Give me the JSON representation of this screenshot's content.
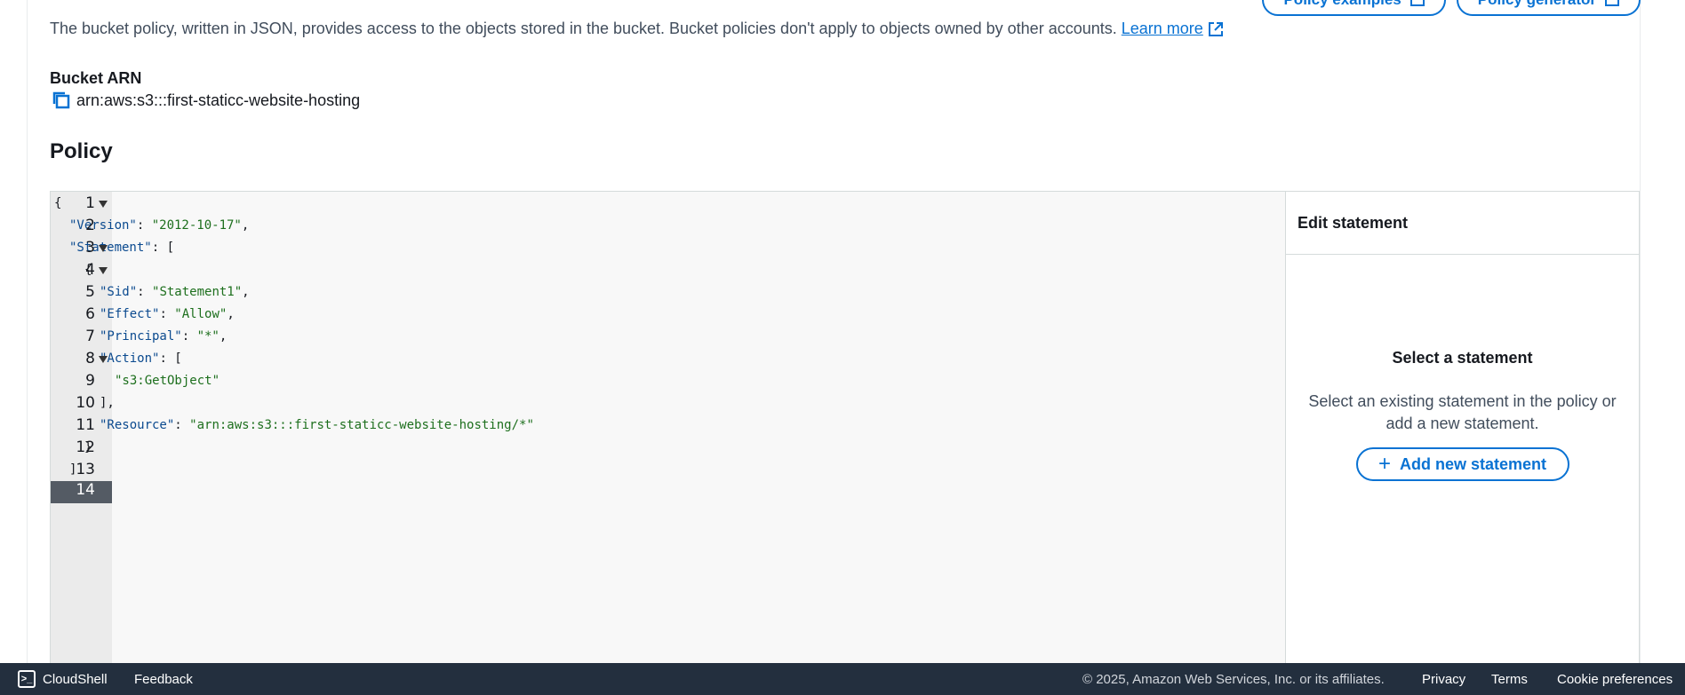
{
  "header_buttons": {
    "policy_examples": "Policy examples",
    "policy_generator": "Policy generator"
  },
  "description": {
    "text": "The bucket policy, written in JSON, provides access to the objects stored in the bucket. Bucket policies don't apply to objects owned by other accounts.",
    "learn_more": "Learn more"
  },
  "bucket_arn": {
    "label": "Bucket ARN",
    "value": "arn:aws:s3:::first-staticc-website-hosting"
  },
  "policy": {
    "title": "Policy",
    "active_line": 14,
    "lines": [
      {
        "num": "1",
        "fold": true,
        "indent": 0,
        "parts": [
          {
            "t": "p",
            "v": "{"
          }
        ]
      },
      {
        "num": "2",
        "fold": false,
        "indent": 1,
        "parts": [
          {
            "t": "k",
            "v": "\"Version\""
          },
          {
            "t": "p",
            "v": ": "
          },
          {
            "t": "s",
            "v": "\"2012-10-17\""
          },
          {
            "t": "p",
            "v": ","
          }
        ]
      },
      {
        "num": "3",
        "fold": true,
        "indent": 1,
        "parts": [
          {
            "t": "k",
            "v": "\"Statement\""
          },
          {
            "t": "p",
            "v": ": ["
          }
        ]
      },
      {
        "num": "4",
        "fold": true,
        "indent": 2,
        "parts": [
          {
            "t": "p",
            "v": "{"
          }
        ]
      },
      {
        "num": "5",
        "fold": false,
        "indent": 3,
        "parts": [
          {
            "t": "k",
            "v": "\"Sid\""
          },
          {
            "t": "p",
            "v": ": "
          },
          {
            "t": "s",
            "v": "\"Statement1\""
          },
          {
            "t": "p",
            "v": ","
          }
        ]
      },
      {
        "num": "6",
        "fold": false,
        "indent": 3,
        "parts": [
          {
            "t": "k",
            "v": "\"Effect\""
          },
          {
            "t": "p",
            "v": ": "
          },
          {
            "t": "s",
            "v": "\"Allow\""
          },
          {
            "t": "p",
            "v": ","
          }
        ]
      },
      {
        "num": "7",
        "fold": false,
        "indent": 3,
        "parts": [
          {
            "t": "k",
            "v": "\"Principal\""
          },
          {
            "t": "p",
            "v": ": "
          },
          {
            "t": "s",
            "v": "\"*\""
          },
          {
            "t": "p",
            "v": ","
          }
        ]
      },
      {
        "num": "8",
        "fold": true,
        "indent": 3,
        "parts": [
          {
            "t": "k",
            "v": "\"Action\""
          },
          {
            "t": "p",
            "v": ": ["
          }
        ]
      },
      {
        "num": "9",
        "fold": false,
        "indent": 4,
        "parts": [
          {
            "t": "s",
            "v": "\"s3:GetObject\""
          }
        ]
      },
      {
        "num": "10",
        "fold": false,
        "indent": 3,
        "parts": [
          {
            "t": "p",
            "v": "],"
          }
        ]
      },
      {
        "num": "11",
        "fold": false,
        "indent": 3,
        "parts": [
          {
            "t": "k",
            "v": "\"Resource\""
          },
          {
            "t": "p",
            "v": ": "
          },
          {
            "t": "s",
            "v": "\"arn:aws:s3:::first-staticc-website-hosting/*\""
          }
        ]
      },
      {
        "num": "12",
        "fold": false,
        "indent": 2,
        "parts": [
          {
            "t": "p",
            "v": "}"
          }
        ]
      },
      {
        "num": "13",
        "fold": false,
        "indent": 1,
        "parts": [
          {
            "t": "p",
            "v": "]"
          }
        ]
      },
      {
        "num": "14",
        "fold": false,
        "indent": 0,
        "parts": [
          {
            "t": "p",
            "v": "}"
          }
        ]
      }
    ]
  },
  "side_panel": {
    "header": "Edit statement",
    "title": "Select a statement",
    "description": "Select an existing statement in the policy or add a new statement.",
    "add_button": "Add new statement"
  },
  "footer": {
    "cloudshell": "CloudShell",
    "feedback": "Feedback",
    "copyright": "© 2025, Amazon Web Services, Inc. or its affiliates.",
    "privacy": "Privacy",
    "terms": "Terms",
    "cookie_preferences": "Cookie preferences"
  },
  "colors": {
    "accent": "#0972d3",
    "footer_bg": "#232f3e",
    "json_key": "#0b4a8f",
    "json_string": "#1d6f1d"
  }
}
